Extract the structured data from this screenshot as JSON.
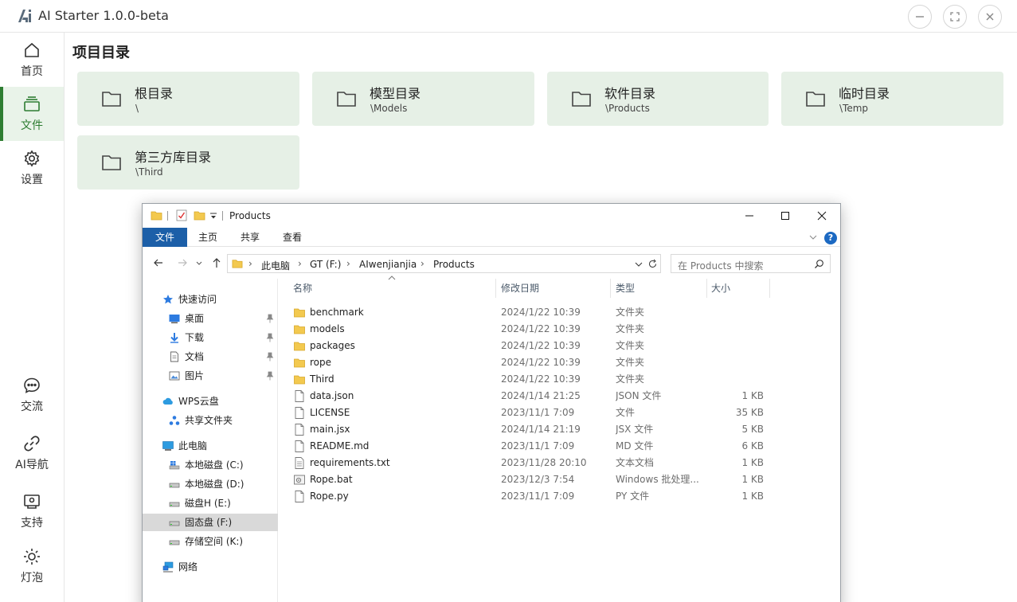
{
  "app": {
    "title": "AI Starter 1.0.0-beta",
    "accent_color": "#2e7d32"
  },
  "sidebar": {
    "items": [
      {
        "label": "首页",
        "icon": "home-icon"
      },
      {
        "label": "文件",
        "icon": "folder-stack-icon",
        "active": true
      },
      {
        "label": "设置",
        "icon": "gear-icon"
      },
      {
        "label": "交流",
        "icon": "chat-icon"
      },
      {
        "label": "AI导航",
        "icon": "link-icon"
      },
      {
        "label": "支持",
        "icon": "support-icon"
      },
      {
        "label": "灯泡",
        "icon": "bulb-icon"
      }
    ]
  },
  "main": {
    "section_title": "项目目录",
    "cards": [
      {
        "name": "根目录",
        "path": "\\"
      },
      {
        "name": "模型目录",
        "path": "\\Models"
      },
      {
        "name": "软件目录",
        "path": "\\Products"
      },
      {
        "name": "临时目录",
        "path": "\\Temp"
      },
      {
        "name": "第三方库目录",
        "path": "\\Third"
      }
    ]
  },
  "explorer": {
    "title": "Products",
    "ribbon": {
      "file": "文件",
      "home": "主页",
      "share": "共享",
      "view": "查看",
      "help": "?"
    },
    "breadcrumb": [
      "此电脑",
      "GT (F:)",
      "AIwenjianjia",
      "Products"
    ],
    "breadcrumb_sep": "›",
    "search_placeholder": "在 Products 中搜索",
    "nav": [
      {
        "label": "快速访问",
        "icon": "star-icon"
      },
      {
        "label": "桌面",
        "icon": "desktop-icon",
        "pinned": true
      },
      {
        "label": "下载",
        "icon": "download-icon",
        "pinned": true
      },
      {
        "label": "文档",
        "icon": "document-icon",
        "pinned": true
      },
      {
        "label": "图片",
        "icon": "picture-icon",
        "pinned": true
      },
      {
        "label": "WPS云盘",
        "icon": "cloud-icon"
      },
      {
        "label": "共享文件夹",
        "icon": "share-folder-icon"
      },
      {
        "label": "此电脑",
        "icon": "computer-icon"
      },
      {
        "label": "本地磁盘 (C:)",
        "icon": "drive-icon"
      },
      {
        "label": "本地磁盘 (D:)",
        "icon": "drive-icon"
      },
      {
        "label": "磁盘H (E:)",
        "icon": "drive-icon"
      },
      {
        "label": "固态盘 (F:)",
        "icon": "drive-icon",
        "selected": true
      },
      {
        "label": "存储空间 (K:)",
        "icon": "drive-icon"
      },
      {
        "label": "网络",
        "icon": "network-icon"
      }
    ],
    "columns": {
      "name": "名称",
      "date": "修改日期",
      "type": "类型",
      "size": "大小"
    },
    "files": [
      {
        "name": "benchmark",
        "date": "2024/1/22 10:39",
        "type": "文件夹",
        "size": "",
        "kind": "folder"
      },
      {
        "name": "models",
        "date": "2024/1/22 10:39",
        "type": "文件夹",
        "size": "",
        "kind": "folder"
      },
      {
        "name": "packages",
        "date": "2024/1/22 10:39",
        "type": "文件夹",
        "size": "",
        "kind": "folder"
      },
      {
        "name": "rope",
        "date": "2024/1/22 10:39",
        "type": "文件夹",
        "size": "",
        "kind": "folder"
      },
      {
        "name": "Third",
        "date": "2024/1/22 10:39",
        "type": "文件夹",
        "size": "",
        "kind": "folder"
      },
      {
        "name": "data.json",
        "date": "2024/1/14 21:25",
        "type": "JSON 文件",
        "size": "1 KB",
        "kind": "file"
      },
      {
        "name": "LICENSE",
        "date": "2023/11/1 7:09",
        "type": "文件",
        "size": "35 KB",
        "kind": "file"
      },
      {
        "name": "main.jsx",
        "date": "2024/1/14 21:19",
        "type": "JSX 文件",
        "size": "5 KB",
        "kind": "file"
      },
      {
        "name": "README.md",
        "date": "2023/11/1 7:09",
        "type": "MD 文件",
        "size": "6 KB",
        "kind": "file"
      },
      {
        "name": "requirements.txt",
        "date": "2023/11/28 20:10",
        "type": "文本文档",
        "size": "1 KB",
        "kind": "text"
      },
      {
        "name": "Rope.bat",
        "date": "2023/12/3 7:54",
        "type": "Windows 批处理...",
        "size": "1 KB",
        "kind": "bat"
      },
      {
        "name": "Rope.py",
        "date": "2023/11/1 7:09",
        "type": "PY 文件",
        "size": "1 KB",
        "kind": "file"
      }
    ]
  }
}
